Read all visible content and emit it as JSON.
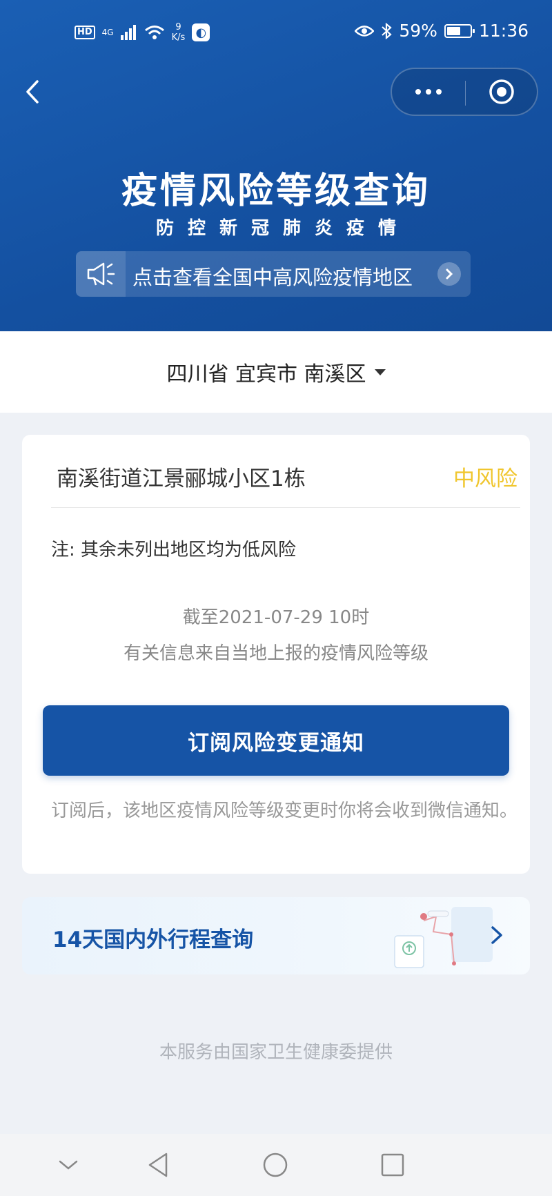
{
  "status_bar": {
    "network": "HD",
    "signal": "4G",
    "speed_value": "9",
    "speed_unit": "K/s",
    "battery_percent": "59%",
    "battery_level": 0.59,
    "time": "11:36"
  },
  "header": {
    "title": "疫情风险等级查询",
    "subtitle": "防控新冠肺炎疫情",
    "notice_text": "点击查看全国中高风险疫情地区"
  },
  "location": {
    "label": "四川省 宜宾市 南溪区"
  },
  "risk_card": {
    "area_name": "南溪街道江景郦城小区1栋",
    "area_level": "中风险",
    "note": "注: 其余未列出地区均为低风险",
    "as_of": "截至2021-07-29 10时",
    "source": "有关信息来自当地上报的疫情风险等级",
    "subscribe_button": "订阅风险变更通知",
    "subscribe_desc": "订阅后，该地区疫情风险等级变更时你将会收到微信通知。"
  },
  "travel": {
    "title": "14天国内外行程查询"
  },
  "footer": {
    "text": "本服务由国家卫生健康委提供"
  },
  "colors": {
    "brand": "#1654a6",
    "medium_risk": "#f0c62e"
  }
}
